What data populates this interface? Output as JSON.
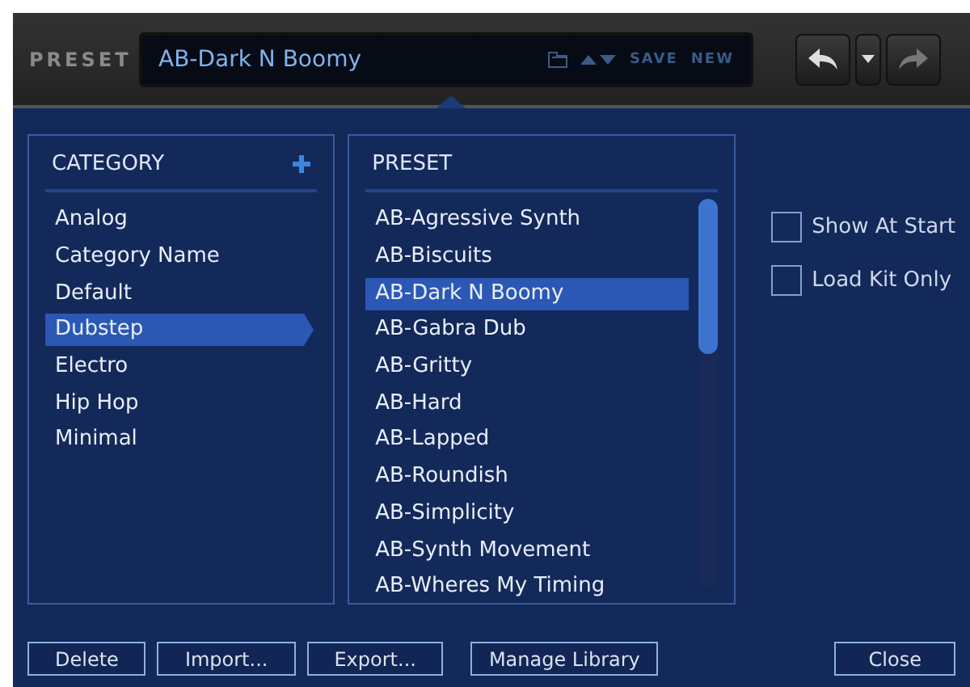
{
  "header": {
    "label": "PRESET",
    "preset_name": "AB-Dark N Boomy",
    "actions": [
      "SAVE",
      "NEW"
    ]
  },
  "categories": {
    "title": "CATEGORY",
    "items": [
      {
        "label": "Analog",
        "selected": false
      },
      {
        "label": "Category Name",
        "selected": false
      },
      {
        "label": "Default",
        "selected": false
      },
      {
        "label": "Dubstep",
        "selected": true
      },
      {
        "label": "Electro",
        "selected": false
      },
      {
        "label": "Hip Hop",
        "selected": false
      },
      {
        "label": "Minimal",
        "selected": false
      }
    ]
  },
  "presets": {
    "title": "PRESET",
    "items": [
      {
        "label": "AB-Agressive Synth",
        "selected": false
      },
      {
        "label": "AB-Biscuits",
        "selected": false
      },
      {
        "label": "AB-Dark N Boomy",
        "selected": true
      },
      {
        "label": "AB-Gabra Dub",
        "selected": false
      },
      {
        "label": "AB-Gritty",
        "selected": false
      },
      {
        "label": "AB-Hard",
        "selected": false
      },
      {
        "label": "AB-Lapped",
        "selected": false
      },
      {
        "label": "AB-Roundish",
        "selected": false
      },
      {
        "label": "AB-Simplicity",
        "selected": false
      },
      {
        "label": "AB-Synth Movement",
        "selected": false
      },
      {
        "label": "AB-Wheres My Timing",
        "selected": false
      }
    ]
  },
  "options": [
    {
      "label": "Show At Start",
      "checked": false
    },
    {
      "label": "Load Kit Only",
      "checked": false
    }
  ],
  "buttons": [
    "Delete",
    "Import...",
    "Export...",
    "Manage Library"
  ],
  "close_button": "Close"
}
